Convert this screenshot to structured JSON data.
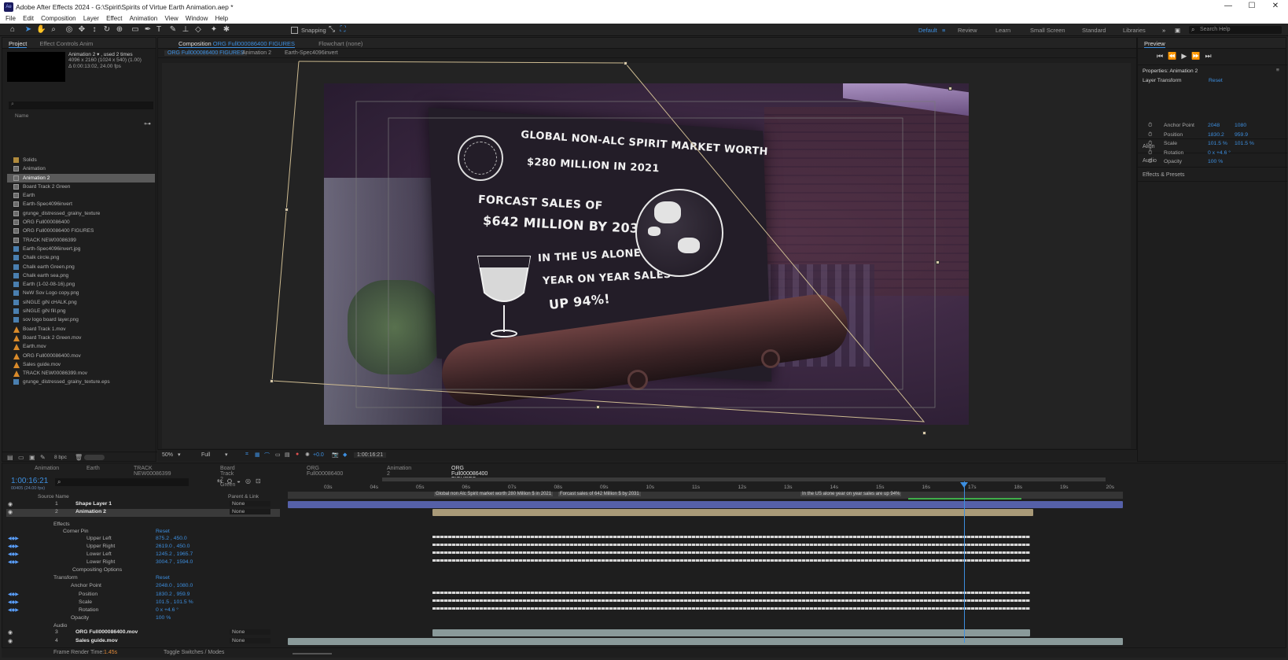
{
  "window": {
    "title": "Adobe After Effects 2024 - G:\\Spirit\\Spirits of Virtue Earth Animation.aep *",
    "app_badge": "Ae"
  },
  "menu": [
    "File",
    "Edit",
    "Composition",
    "Layer",
    "Effect",
    "Animation",
    "View",
    "Window",
    "Help"
  ],
  "toolbar": {
    "snapping_label": "Snapping",
    "workspaces": [
      "Default",
      "Review",
      "Learn",
      "Small Screen",
      "Standard",
      "Libraries"
    ],
    "active_workspace": "Default",
    "search_placeholder": "Search Help"
  },
  "project_panel": {
    "tabs": [
      "Project",
      "Effect Controls Anim"
    ],
    "selected_name": "Animation 2 ▾ , used 2 times",
    "selected_dims": "4096 x 2160  (1024 x 540) (1.00)",
    "selected_duration": "Δ 0:00:13:02, 24.00 fps",
    "column_name": "Name",
    "bpc": "8 bpc",
    "items": [
      {
        "name": "Solids",
        "type": "folder"
      },
      {
        "name": "Animation",
        "type": "comp"
      },
      {
        "name": "Animation 2",
        "type": "comp",
        "selected": true
      },
      {
        "name": "Board Track 2 Green",
        "type": "comp"
      },
      {
        "name": "Earth",
        "type": "comp"
      },
      {
        "name": "Earth-Spec4096invert",
        "type": "comp"
      },
      {
        "name": "grunge_distressed_grainy_texture",
        "type": "comp"
      },
      {
        "name": "ORG Full000086400",
        "type": "comp"
      },
      {
        "name": "ORG Full000086400 FIGURES",
        "type": "comp"
      },
      {
        "name": "TRACK NEW00086399",
        "type": "comp"
      },
      {
        "name": "Earth-Spec4096invert.jpg",
        "type": "img"
      },
      {
        "name": "Chalk circle.png",
        "type": "img"
      },
      {
        "name": "Chalk earth Green.png",
        "type": "img"
      },
      {
        "name": "Chalk earth sea.png",
        "type": "img"
      },
      {
        "name": "Earth (1-02-08-16).png",
        "type": "img"
      },
      {
        "name": "NeW Sov Logo copy.png",
        "type": "img"
      },
      {
        "name": "siNGLE giN cHALK.png",
        "type": "img"
      },
      {
        "name": "siNGLE giN fill.png",
        "type": "img"
      },
      {
        "name": "sov logo board layer.png",
        "type": "img"
      },
      {
        "name": "Board Track 1.mov",
        "type": "mov"
      },
      {
        "name": "Board Track 2 Green.mov",
        "type": "mov"
      },
      {
        "name": "Earth.mov",
        "type": "mov"
      },
      {
        "name": "ORG Full000086400.mov",
        "type": "mov"
      },
      {
        "name": "Sales guide.mov",
        "type": "mov"
      },
      {
        "name": "TRACK NEW00086399.mov",
        "type": "mov"
      },
      {
        "name": "grunge_distressed_grainy_texture.eps",
        "type": "img"
      }
    ]
  },
  "comp_panel": {
    "tab_prefix": "Composition",
    "tab_comp": "ORG Full000086400 FIGURES",
    "flowchart": "Flowchart (none)",
    "breadcrumbs": [
      "ORG Full000086400 FIGURES",
      "Animation 2",
      "Earth-Spec4096invert"
    ],
    "zoom": "50%",
    "resolution": "Full",
    "exposure": "+0.0",
    "timecode": "1:00:16:21"
  },
  "frame_text": {
    "line1": "GLOBAL NON-ALC SPIRIT MARKET WORTH",
    "line2": "$280 MILLION IN 2021",
    "line3": "FORCAST SALES OF",
    "line4": "$642 MILLION BY 2031",
    "line5": "IN THE US ALONE",
    "line6": "YEAR ON YEAR SALES",
    "line7": "UP 94%!"
  },
  "preview_panel": {
    "title": "Preview"
  },
  "properties_panel": {
    "title": "Properties: Animation 2",
    "section": "Layer Transform",
    "reset": "Reset",
    "rows": [
      {
        "label": "Anchor Point",
        "v1": "2048",
        "v2": "1080"
      },
      {
        "label": "Position",
        "v1": "1830.2",
        "v2": "959.9"
      },
      {
        "label": "Scale",
        "v1": "101.5 %",
        "v2": "101.5 %"
      },
      {
        "label": "Rotation",
        "v1": "0 x +4.6 °",
        "v2": ""
      },
      {
        "label": "Opacity",
        "v1": "100 %",
        "v2": ""
      }
    ],
    "collapsed": [
      "Align",
      "Audio",
      "Effects & Presets"
    ]
  },
  "timeline": {
    "tabs": [
      "Animation",
      "Earth",
      "TRACK NEW00086399",
      "Board Track 2 Green",
      "ORG Full000086400",
      "Animation 2",
      "ORG Full000086400 FIGURES"
    ],
    "active_tab": "ORG Full000086400 FIGURES",
    "timecode": "1:00:16:21",
    "frame_sub": "00405 (24.00 fps)",
    "ticks": [
      "03s",
      "04s",
      "05s",
      "06s",
      "07s",
      "08s",
      "09s",
      "10s",
      "11s",
      "12s",
      "13s",
      "14s",
      "15s",
      "16s",
      "17s",
      "18s",
      "19s",
      "20s"
    ],
    "col_source": "Source Name",
    "col_parent": "Parent & Link",
    "markers": [
      "Global non Alc Spirit market worth 280 Million $ in 2021",
      "Forcast sales of 642 Million $ by 2031",
      "In the US alone year on year sales are up 94%"
    ],
    "layers": [
      {
        "num": "1",
        "name": "Shape Layer 1",
        "parent": "None"
      },
      {
        "num": "2",
        "name": "Animation 2",
        "parent": "None"
      },
      {
        "num": "3",
        "name": "ORG Full000086400.mov",
        "parent": "None"
      },
      {
        "num": "4",
        "name": "Sales guide.mov",
        "parent": "None"
      }
    ],
    "props": {
      "effects": "Effects",
      "corner_pin": "Corner Pin",
      "reset": "Reset",
      "ul": "Upper Left",
      "ul_v": "875.2 , 450.0",
      "ur": "Upper Right",
      "ur_v": "2619.0 , 450.0",
      "ll": "Lower Left",
      "ll_v": "1245.2 , 1965.7",
      "lr": "Lower Right",
      "lr_v": "3004.7 , 1594.0",
      "comp_opts": "Compositing Options",
      "transform": "Transform",
      "anchor": "Anchor Point",
      "anchor_v": "2048.0 , 1080.0",
      "position": "Position",
      "position_v": "1830.2 , 959.9",
      "scale": "Scale",
      "scale_v": "101.5 , 101.5 %",
      "rotation": "Rotation",
      "rotation_v": "0 x +4.6 °",
      "opacity": "Opacity",
      "opacity_v": "100 %",
      "audio": "Audio"
    },
    "footer_render_label": "Frame Render Time:",
    "footer_render_value": "1.45s",
    "footer_toggle": "Toggle Switches / Modes"
  }
}
